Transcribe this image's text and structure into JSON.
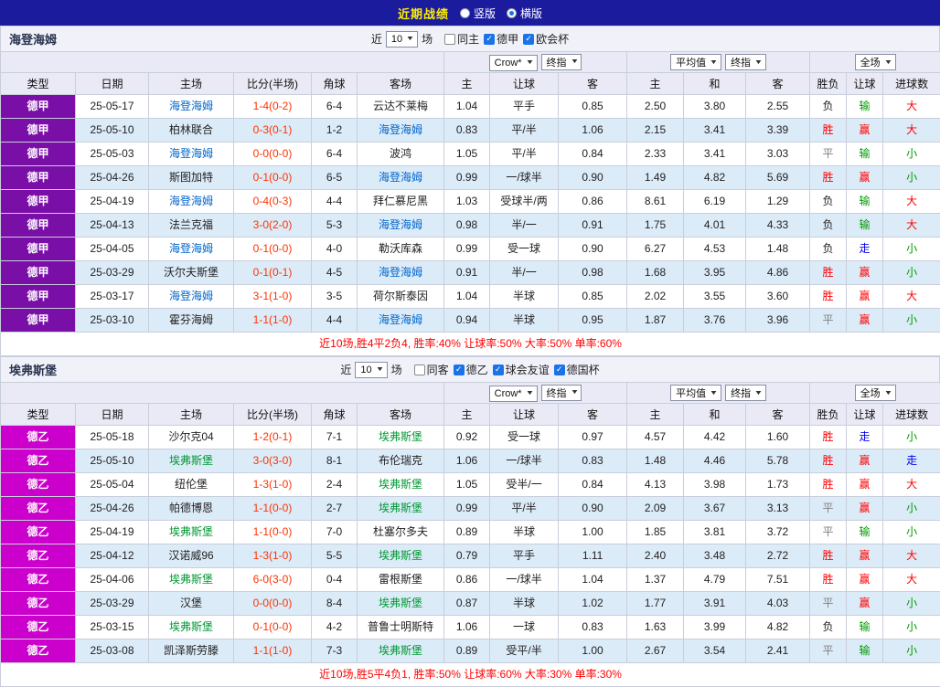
{
  "topbar": {
    "title": "近期战绩",
    "view_options": [
      {
        "name": "vertical",
        "label": "竖版",
        "selected": false
      },
      {
        "name": "horizontal",
        "label": "横版",
        "selected": true
      }
    ]
  },
  "filter_labels": {
    "near": "近",
    "games": "场"
  },
  "table_header": {
    "type": "类型",
    "date": "日期",
    "home": "主场",
    "score": "比分(半场)",
    "corners": "角球",
    "away": "客场",
    "odds_group": {
      "select1": "Crow*",
      "select2": "终指",
      "home": "主",
      "handicap": "让球",
      "away": "客"
    },
    "avg_group": {
      "select1": "平均值",
      "select2": "终指",
      "home": "主",
      "draw": "和",
      "away": "客"
    },
    "full_group": {
      "select1": "全场",
      "result": "胜负",
      "handicap": "让球",
      "goals": "进球数"
    }
  },
  "colors": {
    "accent": "#1a73e8",
    "title": "#ffee00",
    "score": "#ff3300",
    "summary": "#ff0000"
  },
  "league_colors": {
    "德甲": "#7a0fa8",
    "德乙": "#cc00cc"
  },
  "result_colors": {
    "胜": "#ff0000",
    "平": "#808080",
    "负": "#222222",
    "赢": "#ff0000",
    "输": "#009900",
    "走": "#0000ee",
    "大": "#ff0000",
    "小": "#009900"
  },
  "sections": [
    {
      "team": "海登海姆",
      "team_color": "#0066cc",
      "filter": {
        "count": "10",
        "checkboxes": [
          {
            "label": "同主",
            "checked": false
          },
          {
            "label": "德甲",
            "checked": true
          },
          {
            "label": "欧会杯",
            "checked": true
          }
        ]
      },
      "rows": [
        [
          "德甲",
          "25-05-17",
          "海登海姆",
          "1-4(0-2)",
          "6-4",
          "云达不莱梅",
          "1.04",
          "平手",
          "0.85",
          "2.50",
          "3.80",
          "2.55",
          "负",
          "输",
          "大"
        ],
        [
          "德甲",
          "25-05-10",
          "柏林联合",
          "0-3(0-1)",
          "1-2",
          "海登海姆",
          "0.83",
          "平/半",
          "1.06",
          "2.15",
          "3.41",
          "3.39",
          "胜",
          "赢",
          "大"
        ],
        [
          "德甲",
          "25-05-03",
          "海登海姆",
          "0-0(0-0)",
          "6-4",
          "波鸿",
          "1.05",
          "平/半",
          "0.84",
          "2.33",
          "3.41",
          "3.03",
          "平",
          "输",
          "小"
        ],
        [
          "德甲",
          "25-04-26",
          "斯图加特",
          "0-1(0-0)",
          "6-5",
          "海登海姆",
          "0.99",
          "一/球半",
          "0.90",
          "1.49",
          "4.82",
          "5.69",
          "胜",
          "赢",
          "小"
        ],
        [
          "德甲",
          "25-04-19",
          "海登海姆",
          "0-4(0-3)",
          "4-4",
          "拜仁慕尼黑",
          "1.03",
          "受球半/两",
          "0.86",
          "8.61",
          "6.19",
          "1.29",
          "负",
          "输",
          "大"
        ],
        [
          "德甲",
          "25-04-13",
          "法兰克福",
          "3-0(2-0)",
          "5-3",
          "海登海姆",
          "0.98",
          "半/一",
          "0.91",
          "1.75",
          "4.01",
          "4.33",
          "负",
          "输",
          "大"
        ],
        [
          "德甲",
          "25-04-05",
          "海登海姆",
          "0-1(0-0)",
          "4-0",
          "勒沃库森",
          "0.99",
          "受一球",
          "0.90",
          "6.27",
          "4.53",
          "1.48",
          "负",
          "走",
          "小"
        ],
        [
          "德甲",
          "25-03-29",
          "沃尔夫斯堡",
          "0-1(0-1)",
          "4-5",
          "海登海姆",
          "0.91",
          "半/一",
          "0.98",
          "1.68",
          "3.95",
          "4.86",
          "胜",
          "赢",
          "小"
        ],
        [
          "德甲",
          "25-03-17",
          "海登海姆",
          "3-1(1-0)",
          "3-5",
          "荷尔斯泰因",
          "1.04",
          "半球",
          "0.85",
          "2.02",
          "3.55",
          "3.60",
          "胜",
          "赢",
          "大"
        ],
        [
          "德甲",
          "25-03-10",
          "霍芬海姆",
          "1-1(1-0)",
          "4-4",
          "海登海姆",
          "0.94",
          "半球",
          "0.95",
          "1.87",
          "3.76",
          "3.96",
          "平",
          "赢",
          "小"
        ]
      ],
      "summary": "近10场,胜4平2负4, 胜率:40% 让球率:50% 大率:50% 单率:60%"
    },
    {
      "team": "埃弗斯堡",
      "team_color": "#009933",
      "filter": {
        "count": "10",
        "checkboxes": [
          {
            "label": "同客",
            "checked": false
          },
          {
            "label": "德乙",
            "checked": true
          },
          {
            "label": "球会友谊",
            "checked": true
          },
          {
            "label": "德国杯",
            "checked": true
          }
        ]
      },
      "rows": [
        [
          "德乙",
          "25-05-18",
          "沙尔克04",
          "1-2(0-1)",
          "7-1",
          "埃弗斯堡",
          "0.92",
          "受一球",
          "0.97",
          "4.57",
          "4.42",
          "1.60",
          "胜",
          "走",
          "小"
        ],
        [
          "德乙",
          "25-05-10",
          "埃弗斯堡",
          "3-0(3-0)",
          "8-1",
          "布伦瑞克",
          "1.06",
          "一/球半",
          "0.83",
          "1.48",
          "4.46",
          "5.78",
          "胜",
          "赢",
          "走"
        ],
        [
          "德乙",
          "25-05-04",
          "纽伦堡",
          "1-3(1-0)",
          "2-4",
          "埃弗斯堡",
          "1.05",
          "受半/一",
          "0.84",
          "4.13",
          "3.98",
          "1.73",
          "胜",
          "赢",
          "大"
        ],
        [
          "德乙",
          "25-04-26",
          "帕德博恩",
          "1-1(0-0)",
          "2-7",
          "埃弗斯堡",
          "0.99",
          "平/半",
          "0.90",
          "2.09",
          "3.67",
          "3.13",
          "平",
          "赢",
          "小"
        ],
        [
          "德乙",
          "25-04-19",
          "埃弗斯堡",
          "1-1(0-0)",
          "7-0",
          "杜塞尔多夫",
          "0.89",
          "半球",
          "1.00",
          "1.85",
          "3.81",
          "3.72",
          "平",
          "输",
          "小"
        ],
        [
          "德乙",
          "25-04-12",
          "汉诺威96",
          "1-3(1-0)",
          "5-5",
          "埃弗斯堡",
          "0.79",
          "平手",
          "1.11",
          "2.40",
          "3.48",
          "2.72",
          "胜",
          "赢",
          "大"
        ],
        [
          "德乙",
          "25-04-06",
          "埃弗斯堡",
          "6-0(3-0)",
          "0-4",
          "雷根斯堡",
          "0.86",
          "一/球半",
          "1.04",
          "1.37",
          "4.79",
          "7.51",
          "胜",
          "赢",
          "大"
        ],
        [
          "德乙",
          "25-03-29",
          "汉堡",
          "0-0(0-0)",
          "8-4",
          "埃弗斯堡",
          "0.87",
          "半球",
          "1.02",
          "1.77",
          "3.91",
          "4.03",
          "平",
          "赢",
          "小"
        ],
        [
          "德乙",
          "25-03-15",
          "埃弗斯堡",
          "0-1(0-0)",
          "4-2",
          "普鲁士明斯特",
          "1.06",
          "一球",
          "0.83",
          "1.63",
          "3.99",
          "4.82",
          "负",
          "输",
          "小"
        ],
        [
          "德乙",
          "25-03-08",
          "凯泽斯劳滕",
          "1-1(1-0)",
          "7-3",
          "埃弗斯堡",
          "0.89",
          "受平/半",
          "1.00",
          "2.67",
          "3.54",
          "2.41",
          "平",
          "输",
          "小"
        ]
      ],
      "summary": "近10场,胜5平4负1, 胜率:50% 让球率:60% 大率:30% 单率:30%"
    }
  ]
}
